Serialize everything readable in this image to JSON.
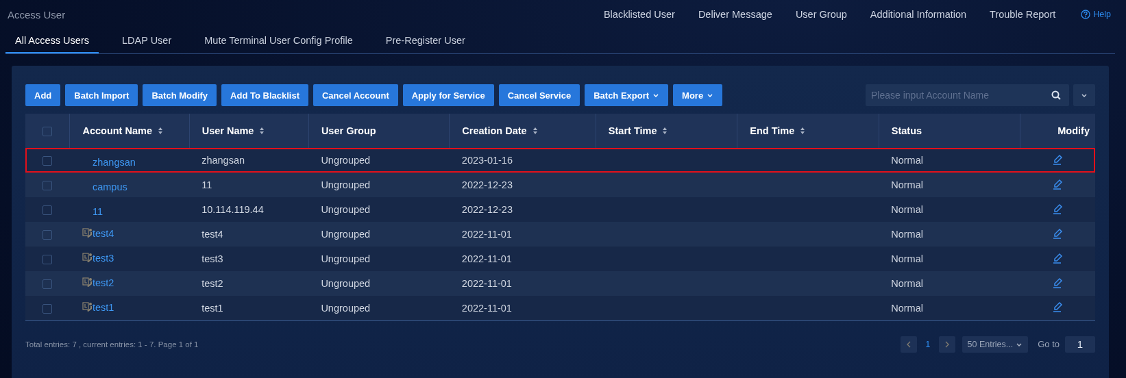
{
  "page": {
    "title": "Access User",
    "help": "Help"
  },
  "top_links": [
    "Blacklisted User",
    "Deliver Message",
    "User Group",
    "Additional Information",
    "Trouble Report"
  ],
  "tabs": [
    {
      "label": "All Access Users",
      "selected": true
    },
    {
      "label": "LDAP User",
      "selected": false
    },
    {
      "label": "Mute Terminal User Config Profile",
      "selected": false
    },
    {
      "label": "Pre-Register User",
      "selected": false
    }
  ],
  "toolbar": [
    {
      "label": "Add",
      "dropdown": false
    },
    {
      "label": "Batch Import",
      "dropdown": false
    },
    {
      "label": "Batch Modify",
      "dropdown": false
    },
    {
      "label": "Add To Blacklist",
      "dropdown": false
    },
    {
      "label": "Cancel Account",
      "dropdown": false
    },
    {
      "label": "Apply for Service",
      "dropdown": false
    },
    {
      "label": "Cancel Service",
      "dropdown": false
    },
    {
      "label": "Batch Export",
      "dropdown": true
    },
    {
      "label": "More",
      "dropdown": true
    }
  ],
  "search": {
    "placeholder": "Please input Account Name"
  },
  "table": {
    "select_all": {
      "checked": false
    },
    "columns": [
      {
        "label": "Account Name",
        "sortable": true
      },
      {
        "label": "User Name",
        "sortable": true
      },
      {
        "label": "User Group",
        "sortable": false
      },
      {
        "label": "Creation Date",
        "sortable": true
      },
      {
        "label": "Start Time",
        "sortable": true
      },
      {
        "label": "End Time",
        "sortable": true
      },
      {
        "label": "Status",
        "sortable": false
      },
      {
        "label": "Modify",
        "sortable": false
      }
    ],
    "rows": [
      {
        "kind": "local",
        "checked": false,
        "highlighted": true,
        "cells": [
          "zhangsan",
          "zhangsan",
          "Ungrouped",
          "2023-01-16",
          "",
          "",
          "Normal"
        ]
      },
      {
        "kind": "local",
        "checked": false,
        "highlighted": false,
        "cells": [
          "campus",
          "11",
          "Ungrouped",
          "2022-12-23",
          "",
          "",
          "Normal"
        ]
      },
      {
        "kind": "local",
        "checked": false,
        "highlighted": false,
        "cells": [
          "11",
          "10.114.119.44",
          "Ungrouped",
          "2022-12-23",
          "",
          "",
          "Normal"
        ]
      },
      {
        "kind": "ldap",
        "checked": false,
        "highlighted": false,
        "cells": [
          "test4",
          "test4",
          "Ungrouped",
          "2022-11-01",
          "",
          "",
          "Normal"
        ]
      },
      {
        "kind": "ldap",
        "checked": false,
        "highlighted": false,
        "cells": [
          "test3",
          "test3",
          "Ungrouped",
          "2022-11-01",
          "",
          "",
          "Normal"
        ]
      },
      {
        "kind": "ldap",
        "checked": false,
        "highlighted": false,
        "cells": [
          "test2",
          "test2",
          "Ungrouped",
          "2022-11-01",
          "",
          "",
          "Normal"
        ]
      },
      {
        "kind": "ldap",
        "checked": false,
        "highlighted": false,
        "cells": [
          "test1",
          "test1",
          "Ungrouped",
          "2022-11-01",
          "",
          "",
          "Normal"
        ]
      }
    ]
  },
  "footer": {
    "summary": "Total entries: 7 , current entries: 1 - 7. Page 1 of 1",
    "pages": [
      {
        "label": "1",
        "selected": true
      }
    ],
    "page_size": "50 Entries...",
    "goto_label": "Go to",
    "goto_value": "1"
  }
}
